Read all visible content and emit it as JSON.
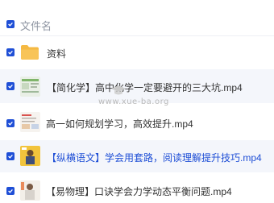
{
  "header": {
    "column_label": "文件名"
  },
  "files": [
    {
      "name": "资料",
      "icon": "folder-icon",
      "selected": false
    },
    {
      "name": "【简化学】高中化学一定要避开的三大坑.mp4",
      "icon": "video-thumbnail",
      "selected": true
    },
    {
      "name": "高一如何规划学习，高效提升.mp4",
      "icon": "video-thumbnail",
      "selected": false
    },
    {
      "name": "【纵横语文】学会用套路，阅读理解提升技巧.mp4",
      "icon": "video-thumbnail",
      "selected": true
    },
    {
      "name": "【易物理】口诀学会力学动态平衡问题.mp4",
      "icon": "video-thumbnail",
      "selected": false
    }
  ],
  "watermark": "www.xue-ba.org",
  "colors": {
    "accent": "#1f4fd6",
    "folder": "#f5b942",
    "highlight_bg": "#f4f6fb"
  }
}
